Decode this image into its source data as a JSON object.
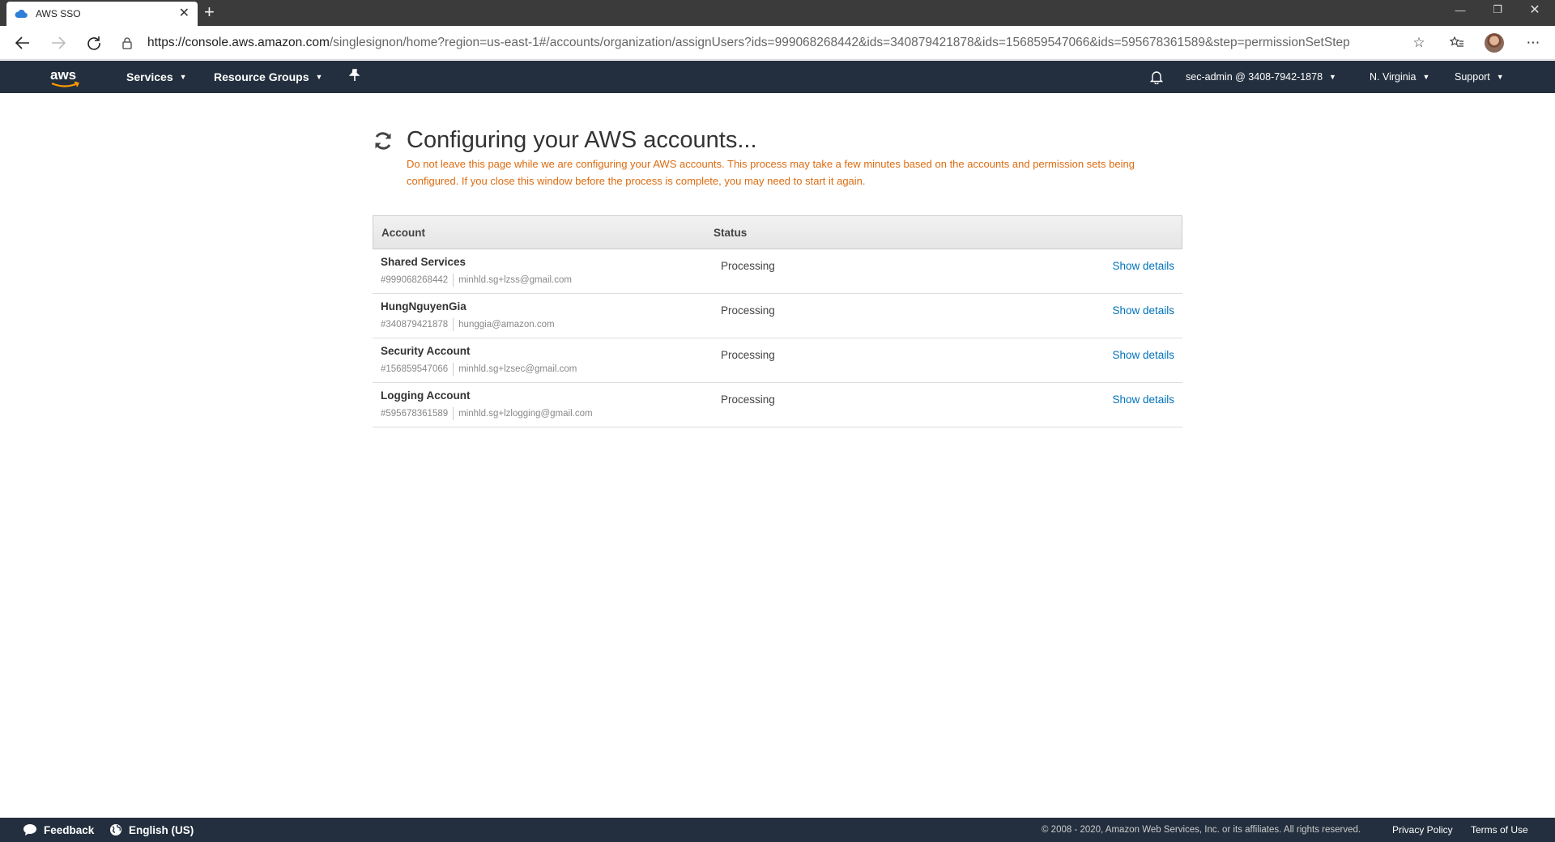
{
  "browser": {
    "tab_title": "AWS SSO",
    "tab_close": "✕",
    "new_tab": "+",
    "url_host": "https://console.aws.amazon.com",
    "url_path": "/singlesignon/home?region=us-east-1#/accounts/organization/assignUsers?ids=999068268442&ids=340879421878&ids=156859547066&ids=595678361589&step=permissionSetStep"
  },
  "awsnav": {
    "services": "Services",
    "resource_groups": "Resource Groups",
    "account": "sec-admin @ 3408-7942-1878",
    "region": "N. Virginia",
    "support": "Support"
  },
  "main": {
    "title": "Configuring your AWS accounts...",
    "warning": "Do not leave this page while we are configuring your AWS accounts. This process may take a few minutes based on the accounts and permission sets being configured. If you close this window before the process is complete, you may need to start it again."
  },
  "table": {
    "headers": {
      "account": "Account",
      "status": "Status"
    },
    "rows": [
      {
        "name": "Shared Services",
        "id": "#999068268442",
        "email": "minhld.sg+lzss@gmail.com",
        "status": "Processing",
        "action": "Show details"
      },
      {
        "name": "HungNguyenGia",
        "id": "#340879421878",
        "email": "hunggia@amazon.com",
        "status": "Processing",
        "action": "Show details"
      },
      {
        "name": "Security Account",
        "id": "#156859547066",
        "email": "minhld.sg+lzsec@gmail.com",
        "status": "Processing",
        "action": "Show details"
      },
      {
        "name": "Logging Account",
        "id": "#595678361589",
        "email": "minhld.sg+lzlogging@gmail.com",
        "status": "Processing",
        "action": "Show details"
      }
    ]
  },
  "footer": {
    "feedback": "Feedback",
    "language": "English (US)",
    "copyright": "© 2008 - 2020, Amazon Web Services, Inc. or its affiliates. All rights reserved.",
    "privacy": "Privacy Policy",
    "terms": "Terms of Use"
  },
  "colors": {
    "nav_bg": "#232f3e",
    "warning": "#dd6b10",
    "link": "#0073bb",
    "aws_orange": "#ff9900"
  },
  "icons": [
    "cloud-icon",
    "back-icon",
    "forward-icon",
    "refresh-icon",
    "lock-icon",
    "star-icon",
    "favorites-icon",
    "more-icon",
    "aws-logo",
    "pin-icon",
    "bell-icon",
    "sync-spinner-icon",
    "chat-icon",
    "globe-icon"
  ]
}
